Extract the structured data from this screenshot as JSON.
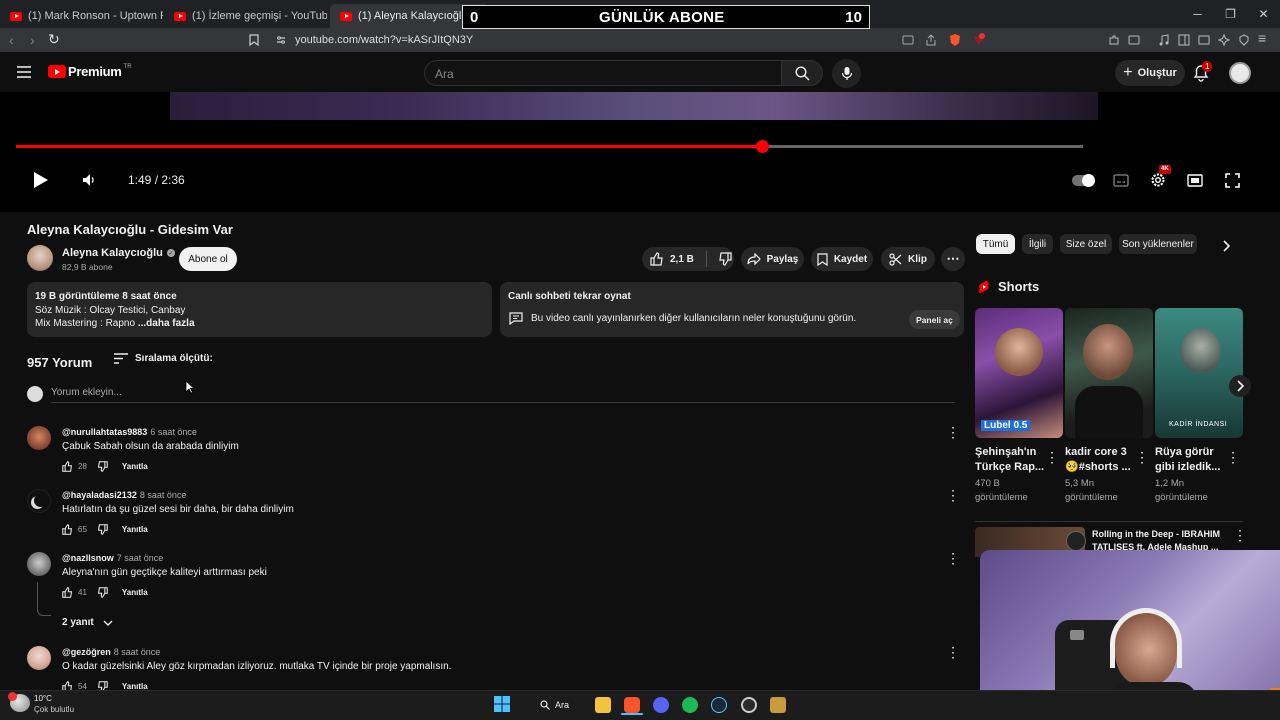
{
  "browser": {
    "tabs": [
      {
        "label": "(1) Mark Ronson - Uptown Funk (Offi"
      },
      {
        "label": "(1) İzleme geçmişi - YouTube"
      },
      {
        "label": "(1) Aleyna Kalaycıoğlu - Gides"
      }
    ],
    "url": "youtube.com/watch?v=kASrJItQN3Y"
  },
  "overlay": {
    "left_count": "0",
    "title": "GÜNLÜK ABONE",
    "right_count": "10"
  },
  "header": {
    "brand": "Premium",
    "brand_sup": "TR",
    "search_placeholder": "Ara",
    "create_label": "Oluştur",
    "notification_count": "1"
  },
  "player": {
    "time": "1:49 / 2:36",
    "progress": 0.7,
    "quality_badge": "4K"
  },
  "video": {
    "title": "Aleyna Kalaycıoğlu - Gidesim Var",
    "channel": "Aleyna Kalaycıoğlu",
    "subscribers": "82,9 B abone",
    "subscribe_label": "Abone ol",
    "likes": "2,1 B",
    "share_label": "Paylaş",
    "save_label": "Kaydet",
    "clip_label": "Klip",
    "description": {
      "stats": "19 B görüntüleme  8 saat önce",
      "line1": "Söz Müzik : Olcay Testici, Canbay",
      "line2_prefix": "Mix Mastering : Rapno",
      "more": "...daha fazla"
    },
    "chat": {
      "title": "Canlı sohbeti tekrar oynat",
      "text": "Bu video canlı yayınlanırken diğer kullanıcıların neler konuştuğunu görün.",
      "button": "Paneli aç"
    }
  },
  "comments_section": {
    "count": "957 Yorum",
    "sort_label": "Sıralama ölçütü:",
    "add_placeholder": "Yorum ekleyin...",
    "reply_label": "Yanıtla",
    "items": [
      {
        "user": "@nurullahtatas9883",
        "time": "6 saat önce",
        "text": "Çabuk Sabah olsun da arabada dinliyim",
        "likes": "28"
      },
      {
        "user": "@hayaladasi2132",
        "time": "8 saat önce",
        "text": "Hatırlatın da şu güzel sesi bir daha, bir daha dinliyim",
        "likes": "65"
      },
      {
        "user": "@nazllsnow",
        "time": "7 saat önce",
        "text": "Aleyna'nın gün geçtikçe kaliteyi arttırması peki",
        "likes": "41",
        "replies": "2 yanıt"
      },
      {
        "user": "@gezöğren",
        "time": "8 saat önce",
        "text": "O kadar güzelsinki  Aley  göz kırpmadan izliyoruz.  mutlaka TV içinde bir proje yapmalısın.",
        "likes": "54"
      }
    ]
  },
  "sidebar": {
    "chips": [
      "Tümü",
      "İlgili",
      "Size özel",
      "Son yüklenenler"
    ],
    "shorts_title": "Shorts",
    "shorts": [
      {
        "title": "Şehinşah'ın Türkçe Rap...",
        "views": "470 B görüntüleme",
        "thumb_text": "Lubel 0.5"
      },
      {
        "title": "kadir core 3 🥺#shorts ...",
        "views": "5,3 Mn görüntüleme",
        "thumb_text": ""
      },
      {
        "title": "Rüya görür gibi izledik...",
        "views": "1,2 Mn görüntüleme",
        "thumb_text": "KADİR İNDANSI"
      }
    ],
    "next_video_title": "Rolling in the Deep - IBRAHIM TATLISES ft. Adele Mashup ..."
  },
  "taskbar": {
    "weather_temp": "10°C",
    "weather_desc": "Çok bulutlu",
    "search_label": "Ara"
  },
  "colors": {
    "accent_red": "#ff0000",
    "background": "#0f0f0f",
    "surface": "#272727"
  }
}
